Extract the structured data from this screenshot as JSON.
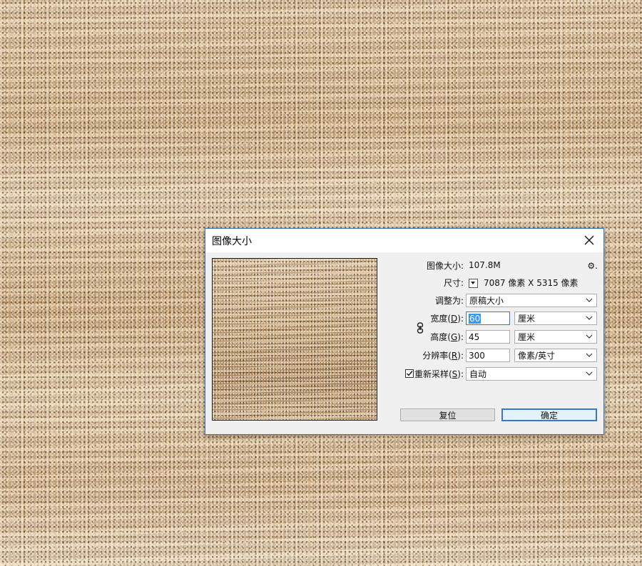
{
  "dialog": {
    "title": "图像大小",
    "image_size_label": "图像大小:",
    "image_size_value": "107.8M",
    "settings_icon": "gear-icon",
    "dimensions_label": "尺寸:",
    "dimensions_value": "7087 像素  X  5315 像素",
    "fit_to_label": "调整为:",
    "fit_to_value": "原稿大小",
    "width_label_pre": "宽度(",
    "width_label_key": "D",
    "width_label_post": "):",
    "width_value": "60",
    "width_unit": "厘米",
    "height_label_pre": "高度(",
    "height_label_key": "G",
    "height_label_post": "):",
    "height_value": "45",
    "height_unit": "厘米",
    "resolution_label_pre": "分辨率(",
    "resolution_label_key": "R",
    "resolution_label_post": "):",
    "resolution_value": "300",
    "resolution_unit": "像素/英寸",
    "resample_label_pre": "重新采样(",
    "resample_label_key": "S",
    "resample_label_post": "):",
    "resample_checked": true,
    "resample_value": "自动",
    "reset_button": "复位",
    "ok_button": "确定"
  }
}
